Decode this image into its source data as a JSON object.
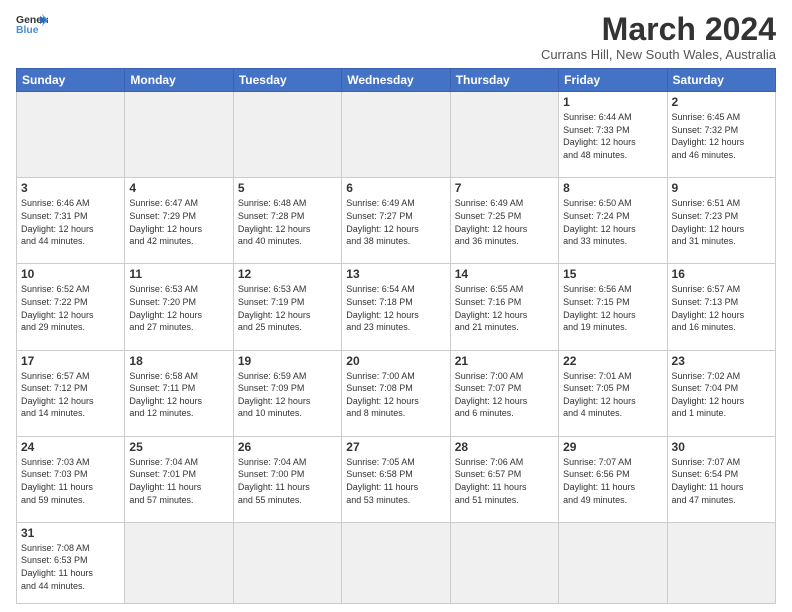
{
  "header": {
    "logo_general": "General",
    "logo_blue": "Blue",
    "month_title": "March 2024",
    "location": "Currans Hill, New South Wales, Australia"
  },
  "weekdays": [
    "Sunday",
    "Monday",
    "Tuesday",
    "Wednesday",
    "Thursday",
    "Friday",
    "Saturday"
  ],
  "weeks": [
    [
      {
        "day": "",
        "info": ""
      },
      {
        "day": "",
        "info": ""
      },
      {
        "day": "",
        "info": ""
      },
      {
        "day": "",
        "info": ""
      },
      {
        "day": "",
        "info": ""
      },
      {
        "day": "1",
        "info": "Sunrise: 6:44 AM\nSunset: 7:33 PM\nDaylight: 12 hours\nand 48 minutes."
      },
      {
        "day": "2",
        "info": "Sunrise: 6:45 AM\nSunset: 7:32 PM\nDaylight: 12 hours\nand 46 minutes."
      }
    ],
    [
      {
        "day": "3",
        "info": "Sunrise: 6:46 AM\nSunset: 7:31 PM\nDaylight: 12 hours\nand 44 minutes."
      },
      {
        "day": "4",
        "info": "Sunrise: 6:47 AM\nSunset: 7:29 PM\nDaylight: 12 hours\nand 42 minutes."
      },
      {
        "day": "5",
        "info": "Sunrise: 6:48 AM\nSunset: 7:28 PM\nDaylight: 12 hours\nand 40 minutes."
      },
      {
        "day": "6",
        "info": "Sunrise: 6:49 AM\nSunset: 7:27 PM\nDaylight: 12 hours\nand 38 minutes."
      },
      {
        "day": "7",
        "info": "Sunrise: 6:49 AM\nSunset: 7:25 PM\nDaylight: 12 hours\nand 36 minutes."
      },
      {
        "day": "8",
        "info": "Sunrise: 6:50 AM\nSunset: 7:24 PM\nDaylight: 12 hours\nand 33 minutes."
      },
      {
        "day": "9",
        "info": "Sunrise: 6:51 AM\nSunset: 7:23 PM\nDaylight: 12 hours\nand 31 minutes."
      }
    ],
    [
      {
        "day": "10",
        "info": "Sunrise: 6:52 AM\nSunset: 7:22 PM\nDaylight: 12 hours\nand 29 minutes."
      },
      {
        "day": "11",
        "info": "Sunrise: 6:53 AM\nSunset: 7:20 PM\nDaylight: 12 hours\nand 27 minutes."
      },
      {
        "day": "12",
        "info": "Sunrise: 6:53 AM\nSunset: 7:19 PM\nDaylight: 12 hours\nand 25 minutes."
      },
      {
        "day": "13",
        "info": "Sunrise: 6:54 AM\nSunset: 7:18 PM\nDaylight: 12 hours\nand 23 minutes."
      },
      {
        "day": "14",
        "info": "Sunrise: 6:55 AM\nSunset: 7:16 PM\nDaylight: 12 hours\nand 21 minutes."
      },
      {
        "day": "15",
        "info": "Sunrise: 6:56 AM\nSunset: 7:15 PM\nDaylight: 12 hours\nand 19 minutes."
      },
      {
        "day": "16",
        "info": "Sunrise: 6:57 AM\nSunset: 7:13 PM\nDaylight: 12 hours\nand 16 minutes."
      }
    ],
    [
      {
        "day": "17",
        "info": "Sunrise: 6:57 AM\nSunset: 7:12 PM\nDaylight: 12 hours\nand 14 minutes."
      },
      {
        "day": "18",
        "info": "Sunrise: 6:58 AM\nSunset: 7:11 PM\nDaylight: 12 hours\nand 12 minutes."
      },
      {
        "day": "19",
        "info": "Sunrise: 6:59 AM\nSunset: 7:09 PM\nDaylight: 12 hours\nand 10 minutes."
      },
      {
        "day": "20",
        "info": "Sunrise: 7:00 AM\nSunset: 7:08 PM\nDaylight: 12 hours\nand 8 minutes."
      },
      {
        "day": "21",
        "info": "Sunrise: 7:00 AM\nSunset: 7:07 PM\nDaylight: 12 hours\nand 6 minutes."
      },
      {
        "day": "22",
        "info": "Sunrise: 7:01 AM\nSunset: 7:05 PM\nDaylight: 12 hours\nand 4 minutes."
      },
      {
        "day": "23",
        "info": "Sunrise: 7:02 AM\nSunset: 7:04 PM\nDaylight: 12 hours\nand 1 minute."
      }
    ],
    [
      {
        "day": "24",
        "info": "Sunrise: 7:03 AM\nSunset: 7:03 PM\nDaylight: 11 hours\nand 59 minutes."
      },
      {
        "day": "25",
        "info": "Sunrise: 7:04 AM\nSunset: 7:01 PM\nDaylight: 11 hours\nand 57 minutes."
      },
      {
        "day": "26",
        "info": "Sunrise: 7:04 AM\nSunset: 7:00 PM\nDaylight: 11 hours\nand 55 minutes."
      },
      {
        "day": "27",
        "info": "Sunrise: 7:05 AM\nSunset: 6:58 PM\nDaylight: 11 hours\nand 53 minutes."
      },
      {
        "day": "28",
        "info": "Sunrise: 7:06 AM\nSunset: 6:57 PM\nDaylight: 11 hours\nand 51 minutes."
      },
      {
        "day": "29",
        "info": "Sunrise: 7:07 AM\nSunset: 6:56 PM\nDaylight: 11 hours\nand 49 minutes."
      },
      {
        "day": "30",
        "info": "Sunrise: 7:07 AM\nSunset: 6:54 PM\nDaylight: 11 hours\nand 47 minutes."
      }
    ],
    [
      {
        "day": "31",
        "info": "Sunrise: 7:08 AM\nSunset: 6:53 PM\nDaylight: 11 hours\nand 44 minutes."
      },
      {
        "day": "",
        "info": ""
      },
      {
        "day": "",
        "info": ""
      },
      {
        "day": "",
        "info": ""
      },
      {
        "day": "",
        "info": ""
      },
      {
        "day": "",
        "info": ""
      },
      {
        "day": "",
        "info": ""
      }
    ]
  ]
}
